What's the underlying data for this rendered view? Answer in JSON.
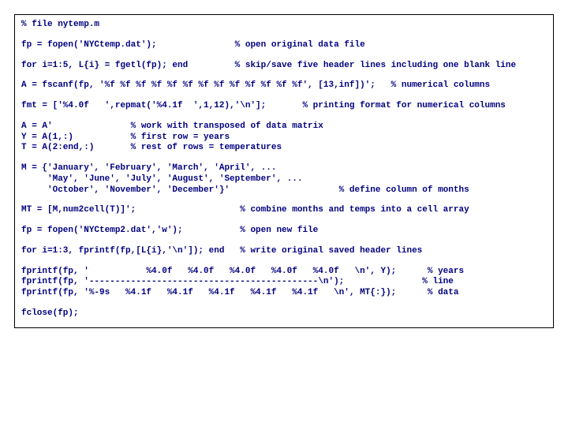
{
  "code": {
    "l01": "% file nytemp.m",
    "l02": "fp = fopen('NYCtemp.dat');               % open original data file",
    "l03": "for i=1:5, L{i} = fgetl(fp); end         % skip/save five header lines including one blank line",
    "l04": "A = fscanf(fp, '%f %f %f %f %f %f %f %f %f %f %f %f %f', [13,inf])';   % numerical columns",
    "l05": "fmt = ['%4.0f   ',repmat('%4.1f  ',1,12),'\\n'];       % printing format for numerical columns",
    "l06": "A = A'               % work with transposed of data matrix",
    "l07": "Y = A(1,:)           % first row = years",
    "l08": "T = A(2:end,:)       % rest of rows = temperatures",
    "l09": "M = {'January', 'February', 'March', 'April', ...",
    "l10": "     'May', 'June', 'July', 'August', 'September', ...",
    "l11": "     'October', 'November', 'December'}'                     % define column of months",
    "l12": "MT = [M,num2cell(T)]';                    % combine months and temps into a cell array",
    "l13": "fp = fopen('NYCtemp2.dat','w');           % open new file",
    "l14": "for i=1:3, fprintf(fp,[L{i},'\\n']); end   % write original saved header lines",
    "l15": "fprintf(fp, '           %4.0f   %4.0f   %4.0f   %4.0f   %4.0f   \\n', Y);      % years",
    "l16": "fprintf(fp, '--------------------------------------------\\n');               % line",
    "l17": "fprintf(fp, '%-9s   %4.1f   %4.1f   %4.1f   %4.1f   %4.1f   \\n', MT{:});      % data",
    "l18": "fclose(fp);"
  }
}
